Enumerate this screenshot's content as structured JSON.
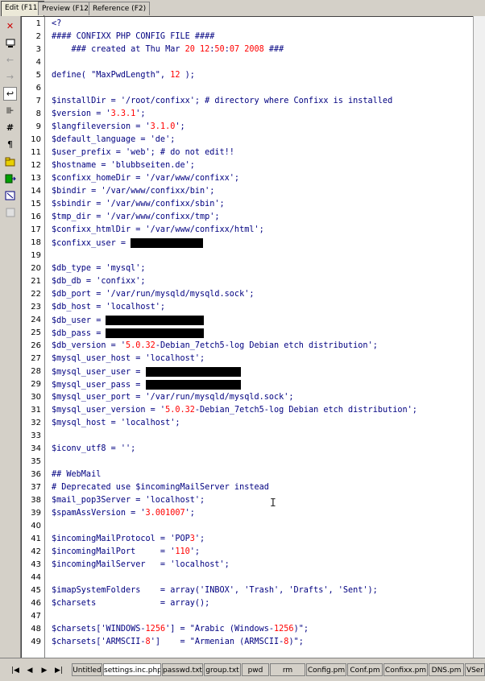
{
  "tabs": [
    "Edit (F11)",
    "Preview (F12)",
    "Reference (F2)"
  ],
  "line_numbers": [
    "1",
    "2",
    "3",
    "4",
    "5",
    "6",
    "7",
    "8",
    "9",
    "10",
    "11",
    "12",
    "13",
    "14",
    "15",
    "16",
    "17",
    "18",
    "19",
    "20",
    "21",
    "22",
    "23",
    "24",
    "25",
    "26",
    "27",
    "28",
    "29",
    "30",
    "31",
    "32",
    "33",
    "34",
    "35",
    "36",
    "37",
    "38",
    "39",
    "40",
    "41",
    "42",
    "43",
    "44",
    "45",
    "46",
    "47",
    "48",
    "49"
  ],
  "code": {
    "l1": "<?",
    "l2": "#### CONFIXX PHP CONFIG FILE ####",
    "l3a": "    ### created at Thu Mar ",
    "l3b": "20 12",
    "l3c": ":",
    "l3d": "50",
    "l3e": ":",
    "l3f": "07 2008",
    "l3g": " ###",
    "l5a": "define( \"MaxPwdLength\", ",
    "l5b": "12",
    "l5c": " );",
    "l7": "$installDir = '/root/confixx'; # directory where Confixx is installed",
    "l8a": "$version = '",
    "l8b": "3.3.1",
    "l8c": "';",
    "l9a": "$langfileversion = '",
    "l9b": "3.1.0",
    "l9c": "';",
    "l10": "$default_language = 'de';",
    "l11": "$user_prefix = 'web'; # do not edit!!",
    "l12": "$hostname = 'blubbseiten.de';",
    "l13": "$confixx_homeDir = '/var/www/confixx';",
    "l14": "$bindir = '/var/www/confixx/bin';",
    "l15": "$sbindir = '/var/www/confixx/sbin';",
    "l16": "$tmp_dir = '/var/www/confixx/tmp';",
    "l17": "$confixx_htmlDir = '/var/www/confixx/html';",
    "l18": "$confixx_user = ",
    "l20": "$db_type = 'mysql';",
    "l21": "$db_db = 'confixx';",
    "l22": "$db_port = '/var/run/mysqld/mysqld.sock';",
    "l23": "$db_host = 'localhost';",
    "l24": "$db_user = ",
    "l25": "$db_pass = ",
    "l26a": "$db_version = '",
    "l26b": "5.0.32",
    "l26c": "-Debian_7etch5-log Debian etch distribution';",
    "l27": "$mysql_user_host = 'localhost';",
    "l28": "$mysql_user_user = ",
    "l29": "$mysql_user_pass = ",
    "l30": "$mysql_user_port = '/var/run/mysqld/mysqld.sock';",
    "l31a": "$mysql_user_version = '",
    "l31b": "5.0.32",
    "l31c": "-Debian_7etch5-log Debian etch distribution';",
    "l32": "$mysql_host = 'localhost';",
    "l34": "$iconv_utf8 = '';",
    "l36": "## WebMail",
    "l37": "# Deprecated use $incomingMailServer instead",
    "l38": "$mail_pop3Server = 'localhost';",
    "l39a": "$spamAssVersion = '",
    "l39b": "3.001007",
    "l39c": "';",
    "l41a": "$incomingMailProtocol = 'POP",
    "l41b": "3",
    "l41c": "';",
    "l42a": "$incomingMailPort     = '",
    "l42b": "110",
    "l42c": "';",
    "l43": "$incomingMailServer   = 'localhost';",
    "l45": "$imapSystemFolders    = array('INBOX', 'Trash', 'Drafts', 'Sent');",
    "l46": "$charsets             = array();",
    "l48a": "$charsets['WINDOWS-",
    "l48b": "1256",
    "l48c": "'] = \"Arabic (Windows-",
    "l48d": "1256",
    "l48e": ")\";",
    "l49a": "$charsets['ARMSCII-",
    "l49b": "8",
    "l49c": "']    = \"Armenian (ARMSCII-",
    "l49d": "8",
    "l49e": ")\";"
  },
  "file_tabs": [
    "Untitled",
    "settings.inc.php",
    "passwd.txt",
    "group.txt",
    "pwd",
    "rm",
    "Config.pm",
    "Conf.pm",
    "Confixx.pm",
    "DNS.pm",
    "VSer"
  ],
  "active_file_tab": "settings.inc.php",
  "nav_buttons": [
    "|◀",
    "◀",
    "▶",
    "▶|"
  ],
  "toolbar_icons": [
    "close-icon",
    "monitor-icon",
    "back-arrow-icon",
    "forward-arrow-icon",
    "word-wrap-icon",
    "insert-icon",
    "hash-icon",
    "paragraph-icon",
    "folder-icon",
    "save-as-icon",
    "resize-icon",
    "blank-icon"
  ],
  "colors": {
    "code_text": "#000080",
    "number": "#ff0000",
    "redaction": "#000000"
  }
}
